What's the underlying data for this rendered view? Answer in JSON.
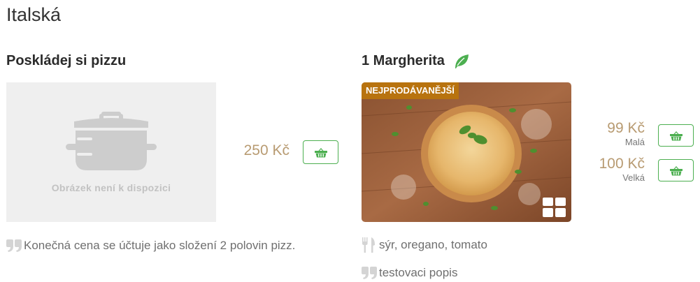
{
  "category": {
    "title": "Italská"
  },
  "custom_pizza": {
    "title": "Poskládej si pizzu",
    "image_placeholder_text": "Obrázek není k dispozici",
    "price": "250 Kč",
    "note": "Konečná cena se účtuje jako složení 2 polovin pizz."
  },
  "margherita": {
    "title": "1 Margherita",
    "badge": "NEJPRODÁVANĚJŠÍ",
    "variants": [
      {
        "price": "99 Kč",
        "size": "Malá"
      },
      {
        "price": "100 Kč",
        "size": "Velká"
      }
    ],
    "ingredients": "sýr, oregano, tomato",
    "description": "testovaci popis"
  },
  "colors": {
    "accent_green": "#4caf50",
    "price_gold": "#b89b72",
    "badge_bg": "#b8730f",
    "icon_gray": "#d0d0d0"
  },
  "icons": {
    "placeholder": "cooking-pot-icon",
    "cart": "basket-icon",
    "vegetarian": "leaf-icon",
    "ingredients": "fork-knife-icon",
    "description": "quote-icon",
    "gallery": "grid-icon"
  }
}
